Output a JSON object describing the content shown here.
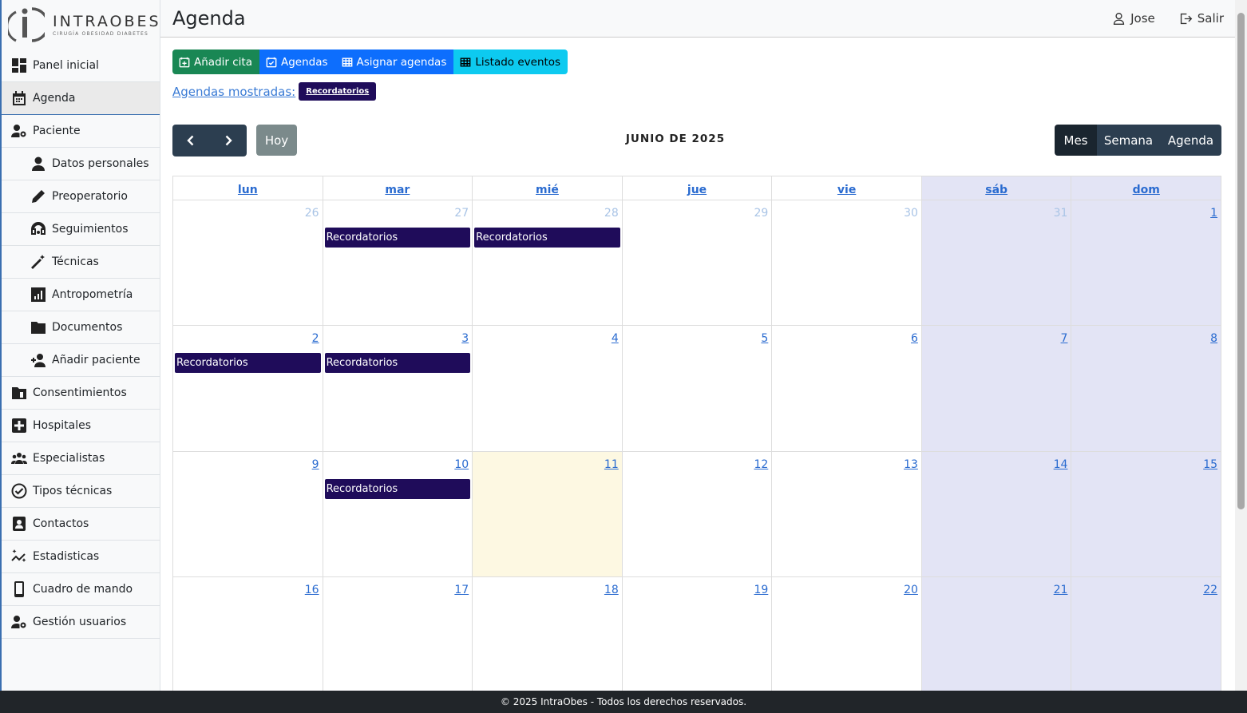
{
  "brand": {
    "name": "INTRAOBES",
    "tagline": "CIRUGÍA OBESIDAD DIABETES"
  },
  "header": {
    "title": "Agenda",
    "user": "Jose",
    "logout": "Salir"
  },
  "sidebar": {
    "items": [
      {
        "label": "Panel inicial",
        "icon": "dashboard-icon"
      },
      {
        "label": "Agenda",
        "icon": "calendar-icon"
      },
      {
        "label": "Paciente",
        "icon": "user-gear-icon"
      },
      {
        "label": "Datos personales",
        "icon": "person-icon"
      },
      {
        "label": "Preoperatorio",
        "icon": "pencil-icon"
      },
      {
        "label": "Seguimientos",
        "icon": "headset-icon"
      },
      {
        "label": "Técnicas",
        "icon": "magic-wand-icon"
      },
      {
        "label": "Antropometría",
        "icon": "bar-chart-icon"
      },
      {
        "label": "Documentos",
        "icon": "folder-icon"
      },
      {
        "label": "Añadir paciente",
        "icon": "person-add-icon"
      },
      {
        "label": "Consentimientos",
        "icon": "folder-doc-icon"
      },
      {
        "label": "Hospitales",
        "icon": "hospital-plus-icon"
      },
      {
        "label": "Especialistas",
        "icon": "group-icon"
      },
      {
        "label": "Tipos técnicas",
        "icon": "check-circle-icon"
      },
      {
        "label": "Contactos",
        "icon": "contact-card-icon"
      },
      {
        "label": "Estadisticas",
        "icon": "sparkle-chart-icon"
      },
      {
        "label": "Cuadro de mando",
        "icon": "phone-icon"
      },
      {
        "label": "Gestión usuarios",
        "icon": "user-gear-icon"
      }
    ]
  },
  "toolbar": {
    "add": "Añadir cita",
    "agendas": "Agendas",
    "assign": "Asignar agendas",
    "list": "Listado eventos"
  },
  "shown": {
    "label": "Agendas mostradas:",
    "badge": "Recordatorios"
  },
  "calendar": {
    "prev_icon": "chevron-left-icon",
    "next_icon": "chevron-right-icon",
    "today": "Hoy",
    "title": "JUNIO DE 2025",
    "views": [
      "Mes",
      "Semana",
      "Agenda"
    ],
    "active_view": "Mes",
    "weekdays": [
      "lun",
      "mar",
      "mié",
      "jue",
      "vie",
      "sáb",
      "dom"
    ],
    "weeks": [
      [
        "26",
        "27",
        "28",
        "29",
        "30",
        "31",
        "1"
      ],
      [
        "2",
        "3",
        "4",
        "5",
        "6",
        "7",
        "8"
      ],
      [
        "9",
        "10",
        "11",
        "12",
        "13",
        "14",
        "15"
      ],
      [
        "16",
        "17",
        "18",
        "19",
        "20",
        "21",
        "22"
      ]
    ],
    "today_date": "11",
    "event_label": "Recordatorios",
    "event_color": "#1f0c5a",
    "events": [
      [
        "27",
        "28"
      ],
      [
        "2",
        "3"
      ],
      [
        "10"
      ],
      []
    ]
  },
  "footer": {
    "text": "© 2025 IntraObes - Todos los derechos reservados."
  }
}
